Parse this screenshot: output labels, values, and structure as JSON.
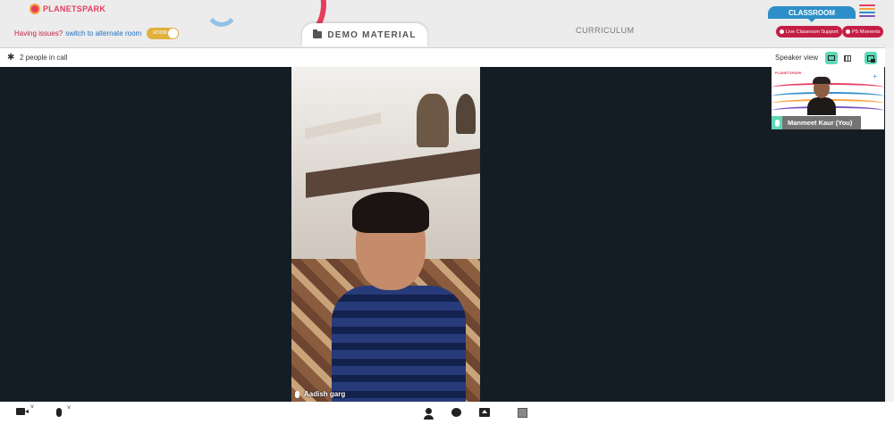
{
  "brand": {
    "logo_text": "PLANETSPARK"
  },
  "header": {
    "issues_question": "Having issues?",
    "issues_link": "switch to alternate room",
    "room_toggle_label": "ROOM",
    "demo_material_label": "DEMO MATERIAL",
    "curriculum_label": "CURRICULUM",
    "classroom_tab_label": "CLASSROOM",
    "live_support_label": "Live Classroom Support",
    "ps_moments_label": "PS Moments"
  },
  "infobar": {
    "people_count_text": "2 people in call",
    "view_mode_label": "Speaker view"
  },
  "participants": {
    "main": {
      "name": "Aadish garg"
    },
    "self": {
      "name": "Manmeet Kaur (You)",
      "mini_logo": "PLANETSPARK"
    }
  },
  "colors": {
    "brand_red": "#e63d5d",
    "classroom_blue": "#2e8fc8",
    "accent_green": "#5fd7b5",
    "video_bg": "#151d24",
    "pill_red": "#c51e45"
  },
  "icons": {
    "settings": "gear-icon",
    "camera": "video-camera-icon",
    "mic": "microphone-icon",
    "participants": "person-icon",
    "chat": "chat-bubble-icon",
    "share": "screen-share-icon",
    "whiteboard": "whiteboard-icon"
  }
}
